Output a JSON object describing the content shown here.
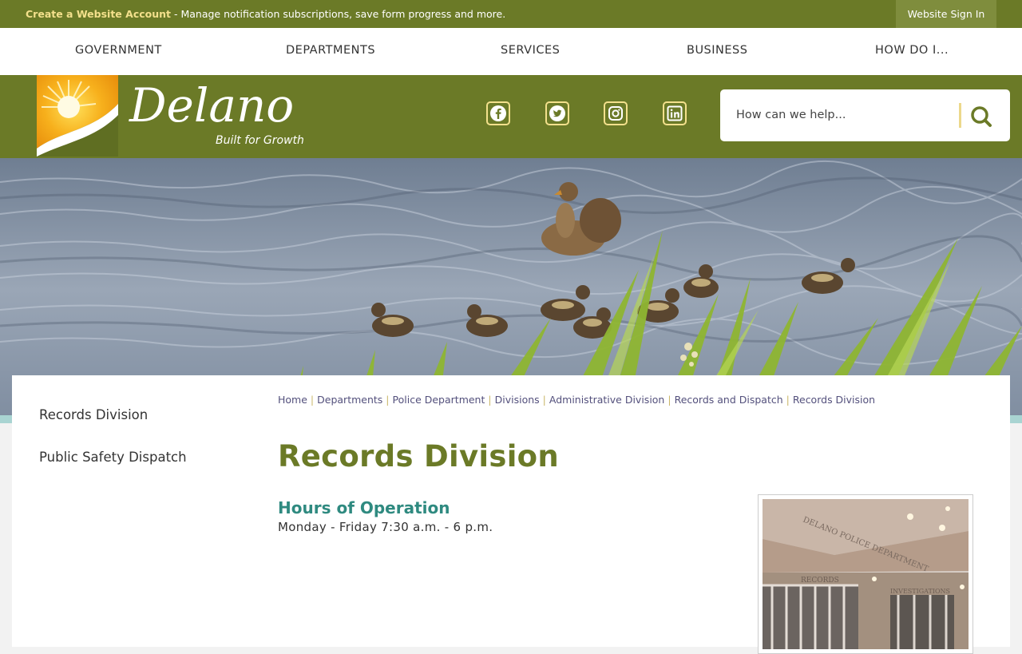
{
  "topbar": {
    "create_account": "Create a Website Account",
    "promo_text": " - Manage notification subscriptions, save form progress and more.",
    "signin": "Website Sign In"
  },
  "nav": {
    "items": [
      "GOVERNMENT",
      "DEPARTMENTS",
      "SERVICES",
      "BUSINESS",
      "HOW DO I..."
    ]
  },
  "header": {
    "logo_name": "Delano",
    "logo_tagline": "Built for Growth",
    "social": [
      "facebook-icon",
      "twitter-icon",
      "instagram-icon",
      "linkedin-icon"
    ],
    "search_placeholder": "How can we help..."
  },
  "sidebar": {
    "items": [
      "Records Division",
      "Public Safety Dispatch"
    ]
  },
  "breadcrumb": [
    "Home",
    "Departments",
    "Police Department",
    "Divisions",
    "Administrative Division",
    "Records and Dispatch",
    "Records Division"
  ],
  "main": {
    "title": "Records Division",
    "hours_heading": "Hours of Operation",
    "hours_text": "Monday - Friday 7:30 a.m. - 6 p.m."
  },
  "photo": {
    "sign_main": "DELANO POLICE DEPARTMENT",
    "sign_records": "RECORDS",
    "sign_investigations": "INVESTIGATIONS"
  },
  "colors": {
    "brand_green": "#6b7a27",
    "accent_yellow": "#f3e08c",
    "heading_teal": "#2f8a80",
    "crumb_purple": "#53507c"
  }
}
